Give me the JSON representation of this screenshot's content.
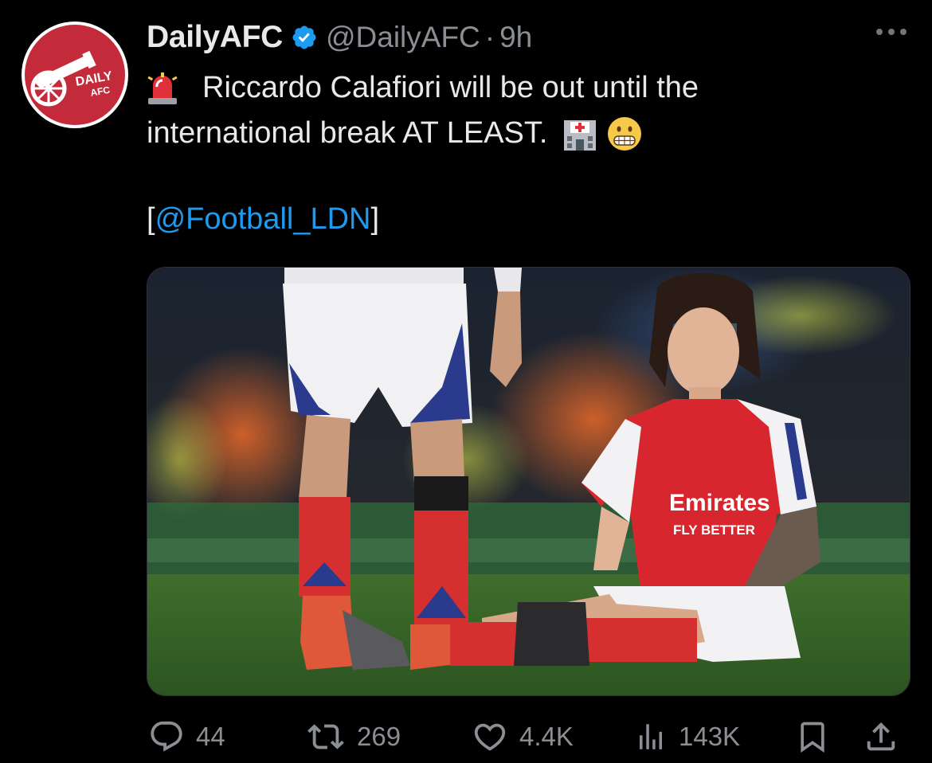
{
  "account": {
    "display_name": "DailyAFC",
    "handle": "@DailyAFC",
    "separator": "·",
    "time": "9h",
    "avatar_text_top": "DAILY",
    "avatar_text_bottom": "AFC",
    "verified_icon": "verified-badge-icon"
  },
  "tweet": {
    "text_line1": "Riccardo Calafiori will be out until the",
    "text_line2": "international break AT LEAST.",
    "source_open": "[",
    "source_mention": "@Football_LDN",
    "source_close": "]",
    "emojis": [
      "siren-icon",
      "hospital-icon",
      "grimacing-face-icon"
    ]
  },
  "media": {
    "jersey_sponsor_line1": "Emirates",
    "jersey_sponsor_line2": "FLY BETTER"
  },
  "actions": {
    "replies": "44",
    "reposts": "269",
    "likes": "4.4K",
    "views": "143K"
  },
  "colors": {
    "background": "#000000",
    "text": "#e7e9ea",
    "secondary": "#8b8f94",
    "link": "#1d9bf0",
    "verified": "#1d9bf0",
    "arsenal_red": "#c42b3a"
  }
}
